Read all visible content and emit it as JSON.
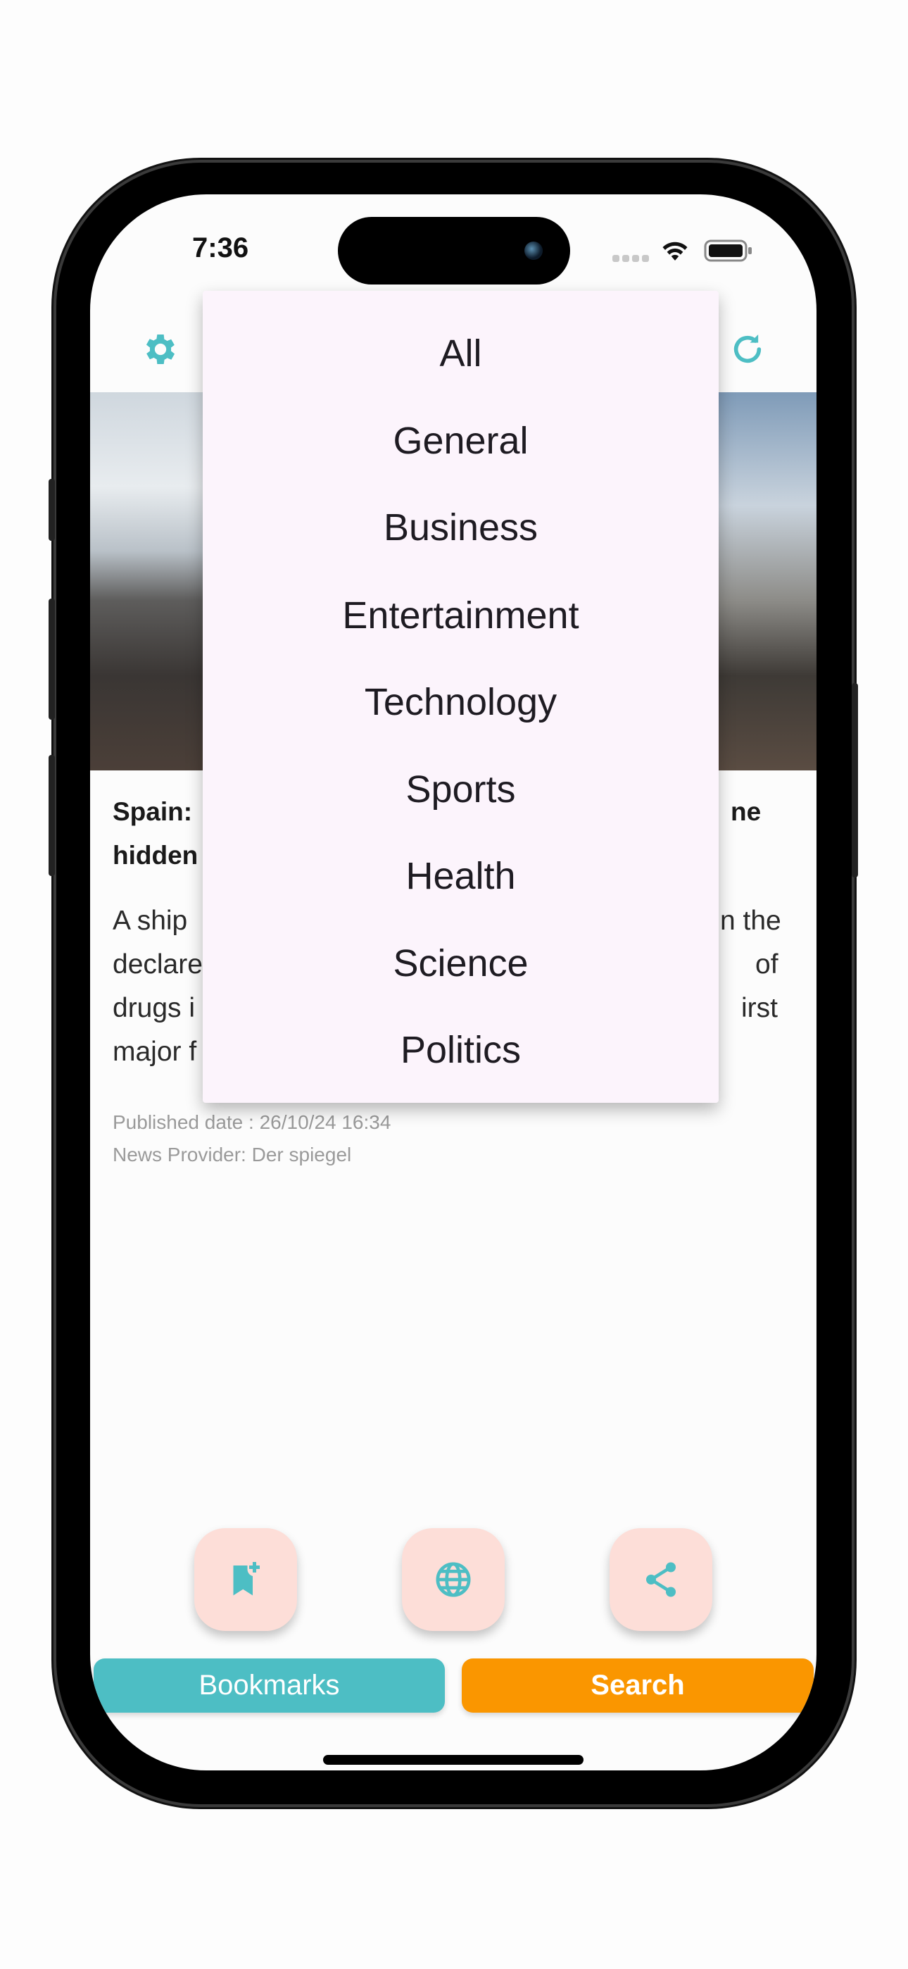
{
  "status_bar": {
    "time": "7:36"
  },
  "header": {
    "settings_icon": "gear-icon",
    "refresh_icon": "refresh-icon",
    "accent": "#4dbec4"
  },
  "category_menu": {
    "items": [
      "All",
      "General",
      "Business",
      "Entertainment",
      "Technology",
      "Sports",
      "Health",
      "Science",
      "Politics"
    ]
  },
  "article": {
    "title_visible_fragments": [
      [
        "Spain:",
        "ne"
      ],
      [
        "hidden",
        ""
      ]
    ],
    "body_visible_fragments": [
      [
        "A ship",
        "n the"
      ],
      [
        "declare",
        "of"
      ],
      [
        "drugs i",
        "irst"
      ],
      [
        "major f",
        ""
      ]
    ],
    "published": "Published date : 26/10/24 16:34",
    "provider": "News Provider: Der spiegel"
  },
  "actions": [
    {
      "icon": "bookmark-add-icon"
    },
    {
      "icon": "globe-icon"
    },
    {
      "icon": "share-icon"
    }
  ],
  "bottom": {
    "bookmarks_label": "Bookmarks",
    "search_label": "Search",
    "bookmarks_color": "#4dbec4",
    "search_color": "#fa9600"
  }
}
